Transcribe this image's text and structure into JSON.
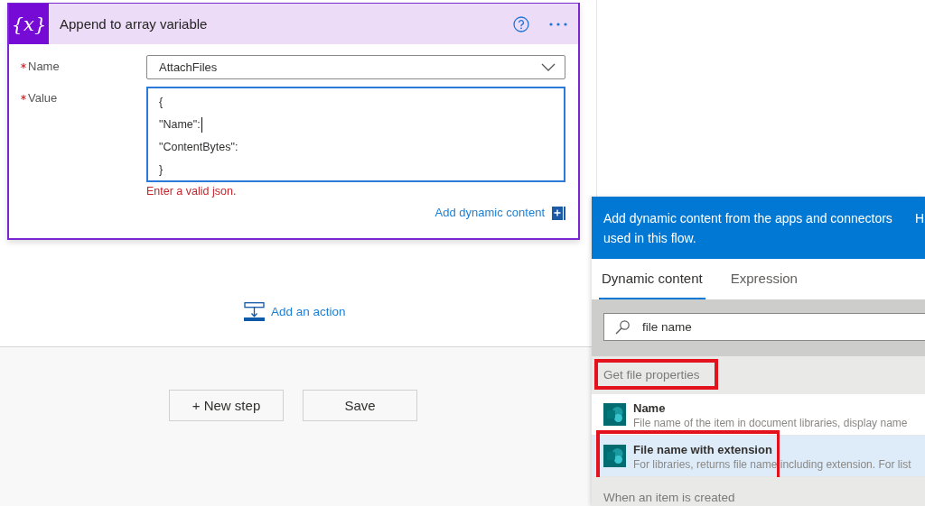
{
  "card": {
    "icon_text": "{x}",
    "title": "Append to array variable",
    "fields": [
      {
        "kind": "dropdown",
        "label": "Name",
        "required": true,
        "value": "AttachFiles"
      },
      {
        "kind": "textarea",
        "label": "Value",
        "required": true,
        "focused": true,
        "lines": [
          {
            "text": "{",
            "caret": false
          },
          {
            "text": "\"Name\":",
            "caret": true
          },
          {
            "text": "\"ContentBytes\":",
            "caret": false
          },
          {
            "text": "}",
            "caret": false
          }
        ],
        "error": "Enter a valid json."
      }
    ],
    "dynamic_link": "Add dynamic content"
  },
  "add_action": "Add an action",
  "footer_buttons": [
    "+ New step",
    "Save"
  ],
  "dynamic_panel": {
    "intro": "Add dynamic content from the apps and connectors used in this flow.",
    "hide_link": "H",
    "tabs": [
      {
        "label": "Dynamic content",
        "selected": true
      },
      {
        "label": "Expression",
        "selected": false
      }
    ],
    "search": {
      "value": "file name"
    },
    "groups": [
      {
        "title": "Get file properties",
        "highlighted": true,
        "items": [
          {
            "title": "Name",
            "description": "File name of the item in document libraries, display name",
            "selected": false,
            "highlighted": false
          },
          {
            "title": "File name with extension",
            "description": "For libraries, returns file name including extension. For list",
            "selected": true,
            "highlighted": true
          }
        ]
      },
      {
        "title": "When an item is created",
        "highlighted": false
      }
    ]
  }
}
